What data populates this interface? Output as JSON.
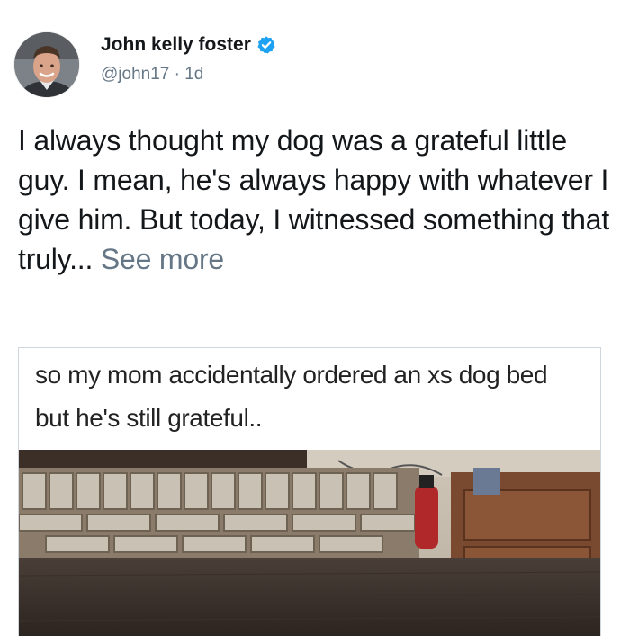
{
  "author": {
    "name": "John kelly foster",
    "handle": "@john17",
    "separator": "·",
    "time": "1d",
    "verified": true,
    "avatar_icon": "profile-photo"
  },
  "tweet": {
    "text": "I always thought my dog was a grateful little guy. I mean, he's always happy with whatever I give him. But today, I witnessed something that truly...",
    "see_more": "See more"
  },
  "media": {
    "caption": "so my mom accidentally ordered an xs dog bed but he's still grateful.."
  },
  "colors": {
    "verified_badge": "#1da1f2",
    "secondary_text": "#657786",
    "primary_text": "#14171a"
  }
}
